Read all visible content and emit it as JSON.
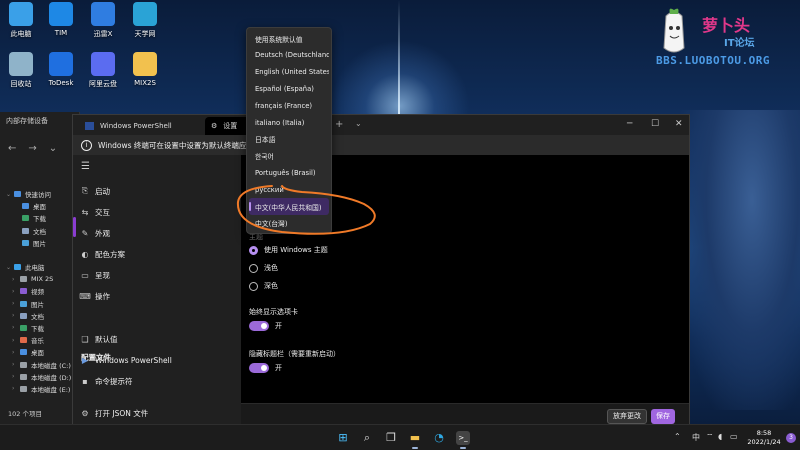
{
  "desktop_icons": [
    {
      "label": "此电脑",
      "icon": "pc-icon",
      "color": "#3aa0e8"
    },
    {
      "label": "TIM",
      "icon": "tim-icon",
      "color": "#1e88e5"
    },
    {
      "label": "迅雷X",
      "icon": "xunlei-icon",
      "color": "#2f7de1"
    },
    {
      "label": "天学网",
      "icon": "tianxue-icon",
      "color": "#2aa3d6"
    },
    {
      "label": "回收站",
      "icon": "recycle-bin-icon",
      "color": "#8fb3c9"
    },
    {
      "label": "ToDesk",
      "icon": "todesk-icon",
      "color": "#1f6fe0"
    },
    {
      "label": "阿里云盘",
      "icon": "aliyun-drive-icon",
      "color": "#5b6cf0"
    },
    {
      "label": "MIX2S",
      "icon": "folder-icon",
      "color": "#f2c14e"
    }
  ],
  "watermark": {
    "title": "萝卜头",
    "subtitle": "IT论坛",
    "url": "BBS.LUOBOTOU.ORG"
  },
  "explorer": {
    "title": "内部存储设备",
    "quick_access": "快速访问",
    "items": [
      {
        "label": "桌面",
        "color": "#4a8fe0"
      },
      {
        "label": "下载",
        "color": "#3aa066"
      },
      {
        "label": "文档",
        "color": "#8aa0c0"
      },
      {
        "label": "图片",
        "color": "#4aa0d8"
      }
    ],
    "this_pc": "此电脑",
    "pc_items": [
      {
        "label": "MIX 2S",
        "color": "#9aa0a6"
      },
      {
        "label": "视频",
        "color": "#8a5cd1"
      },
      {
        "label": "图片",
        "color": "#4aa0d8"
      },
      {
        "label": "文档",
        "color": "#8aa0c0"
      },
      {
        "label": "下载",
        "color": "#3aa066"
      },
      {
        "label": "音乐",
        "color": "#e06a4a"
      },
      {
        "label": "桌面",
        "color": "#4a8fe0"
      },
      {
        "label": "本地磁盘 (C:)",
        "color": "#9aa0a6"
      },
      {
        "label": "本地磁盘 (D:)",
        "color": "#9aa0a6"
      },
      {
        "label": "本地磁盘 (E:)",
        "color": "#9aa0a6"
      }
    ],
    "status": "102 个项目"
  },
  "terminal": {
    "tabs": [
      {
        "label": "Windows PowerShell",
        "icon": "powershell-icon"
      },
      {
        "label": "设置",
        "icon": "gear-icon"
      }
    ],
    "info_text": "Windows 终端可在设置中设置为默认终端应用程序",
    "nav": [
      {
        "label": "启动",
        "icon": "launch-icon"
      },
      {
        "label": "交互",
        "icon": "interaction-icon"
      },
      {
        "label": "外观",
        "icon": "brush-icon"
      },
      {
        "label": "配色方案",
        "icon": "palette-icon"
      },
      {
        "label": "呈现",
        "icon": "monitor-icon"
      },
      {
        "label": "操作",
        "icon": "keyboard-icon"
      }
    ],
    "profiles_header": "配置文件",
    "profiles": [
      {
        "label": "默认值",
        "icon": "layers-icon"
      },
      {
        "label": "Windows PowerShell",
        "icon": "powershell-icon"
      },
      {
        "label": "命令提示符",
        "icon": "cmd-icon"
      }
    ],
    "open_json": "打开 JSON 文件",
    "theme_label": "主题",
    "theme_options": [
      {
        "label": "使用 Windows 主题",
        "selected": true
      },
      {
        "label": "浅色",
        "selected": false
      },
      {
        "label": "深色",
        "selected": false
      }
    ],
    "always_show_tabs_label": "始终显示选项卡",
    "always_show_tabs_state": "开",
    "hide_titlebar_label": "隐藏标题栏（需要重新启动）",
    "hide_titlebar_state": "开",
    "discard_label": "放弃更改",
    "save_label": "保存"
  },
  "language_dropdown": {
    "options": [
      "使用系统默认值",
      "Deutsch (Deutschland)",
      "English (United States)",
      "Español (España)",
      "français (France)",
      "italiano (Italia)",
      "日本語",
      "한국어",
      "Português (Brasil)",
      "русский",
      "中文(中华人民共和国)",
      "中文(台灣)"
    ],
    "selected_index": 10,
    "annotation_color": "#f07a28"
  },
  "taskbar": {
    "apps": [
      {
        "icon": "start-icon",
        "color": "#4cc2ff"
      },
      {
        "icon": "search-icon",
        "color": "#dddddd"
      },
      {
        "icon": "task-view-icon",
        "color": "#dddddd"
      },
      {
        "icon": "file-explorer-icon",
        "color": "#f2c14e"
      },
      {
        "icon": "edge-icon",
        "color": "#2fa7e0"
      },
      {
        "icon": "terminal-icon",
        "color": "#444444"
      }
    ],
    "time": "8:58",
    "date": "2022/1/24",
    "notification_count": "3",
    "lang_indicator": "中"
  }
}
